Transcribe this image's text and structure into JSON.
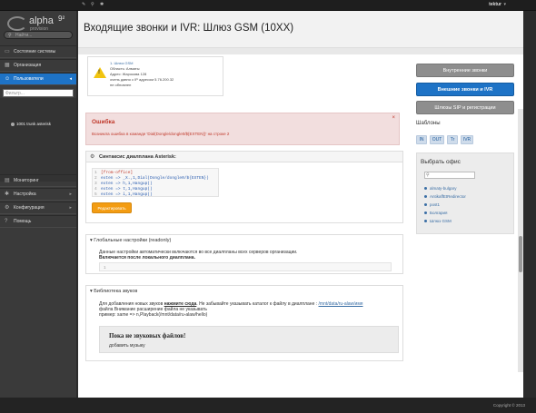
{
  "topbar": {
    "user": "tektur"
  },
  "sidebar": {
    "logo_name": "alpha",
    "logo_sup": "9²",
    "logo_sub": "provision",
    "search_placeholder": "Найти...",
    "items": [
      {
        "label": "Состояние системы",
        "icon": "monitor-icon"
      },
      {
        "label": "Организация",
        "icon": "building-icon"
      },
      {
        "label": "Пользователи",
        "icon": "users-icon",
        "active": true
      }
    ],
    "filter_placeholder": "Фильтр...",
    "tree_node": "1001 trunk asterisk",
    "lower_items": [
      {
        "label": "Мониторинг",
        "icon": "chart-icon"
      },
      {
        "label": "Настройка",
        "icon": "wrench-icon"
      },
      {
        "label": "Конфигурация",
        "icon": "gear-icon"
      },
      {
        "label": "Помощь",
        "icon": "help-icon"
      }
    ]
  },
  "page": {
    "title": "Входящие звонки и IVR: Шлюз GSM (10XX)"
  },
  "info": {
    "line1": "1. Шлюз GSM",
    "line2": "Область: Алматы",
    "line3": "Адрес: Жарокова 128",
    "line4": "очень давно с IP адресом 5.76.200.32",
    "line5": "не обновлен"
  },
  "error": {
    "title": "Ошибка",
    "message": "Возникла ошибка в команде 'Dial(Dongle/dongle0/${EXTEN})' на строке 2"
  },
  "syntax": {
    "title": "Синтаксис диалплана Asterisk:",
    "lines": [
      {
        "n": "1",
        "text": "[from-office]",
        "kind": "ctx"
      },
      {
        "n": "2",
        "text": "exten => _X.,1,Dial(Dongle/dongle0/${EXTEN})",
        "kind": "code"
      },
      {
        "n": "3",
        "text": "exten => h,1,Hangup()",
        "kind": "code"
      },
      {
        "n": "4",
        "text": "exten => t,1,Hangup()",
        "kind": "code"
      },
      {
        "n": "5",
        "text": "exten => i,1,Hangup()",
        "kind": "code"
      }
    ],
    "edit_button": "Редактировать"
  },
  "global": {
    "title": "Глобальные настройки (readonly)",
    "line1": "Данные настройки автоматически включаются во все диалпланы всех серверов организации.",
    "line2": "Включается после локального диалплана.",
    "box": "1"
  },
  "library": {
    "title": "Библиотека звуков",
    "line1_a": "Для добавления новых звуков ",
    "line1_link": "нажмите сюда",
    "line1_b": ". Не забывайте указывать каталог к файлу в диалплане : ",
    "line1_path": "/mnt/data/ru-alaw/имя",
    "line2": "файла Внимание расширение файла не указывать",
    "line3": "пример: same => n,Playback(/mnt/data/ru-alaw/hello)",
    "empty_title": "Пока не звуковых файлов!",
    "empty_sub": "добавить музыку"
  },
  "right": {
    "buttons": [
      {
        "label": "Внутренние звонки",
        "style": "grey"
      },
      {
        "label": "Внешние звонки и IVR",
        "style": "blue"
      },
      {
        "label": "Шлюзы SIP и регистрации",
        "style": "grey"
      }
    ],
    "templates_title": "Шаблоны",
    "tags": [
      "IN",
      "OUT",
      "Tr",
      "IVR"
    ],
    "office_title": "Выбрать офис",
    "offices": [
      "almaty-bulgary",
      "AntikaffEtRedirector",
      "post1",
      "Болгария",
      "Шлюз GSM"
    ]
  },
  "footer": {
    "copy": "Copyright © 2013"
  }
}
